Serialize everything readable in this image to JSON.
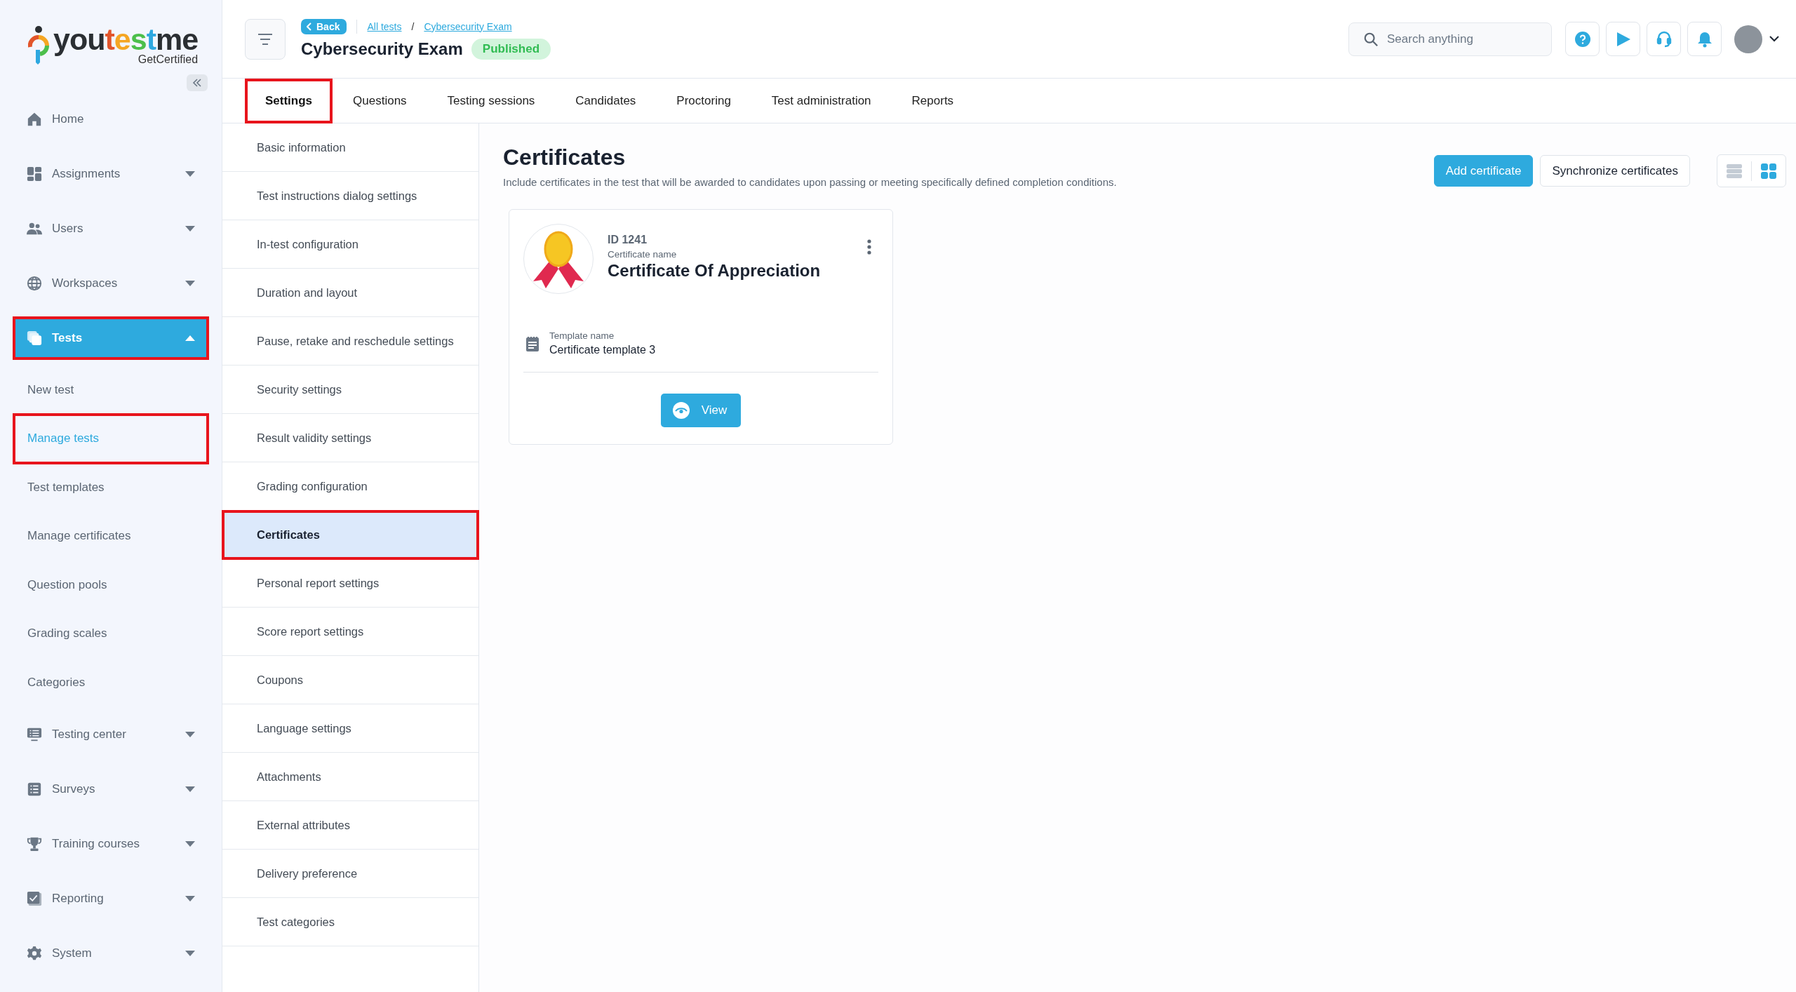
{
  "sidebar": {
    "logo": {
      "parts": [
        {
          "text": "you",
          "color": "#2b2f33"
        },
        {
          "text": "t",
          "color": "#e2552b"
        },
        {
          "text": "e",
          "color": "#f5a623"
        },
        {
          "text": "s",
          "color": "#4cbf4b"
        },
        {
          "text": "t",
          "color": "#2ea8e0"
        },
        {
          "text": "me",
          "color": "#2b2f33"
        }
      ],
      "tagline": "GetCertified"
    },
    "items": [
      {
        "kind": "top",
        "label": "Home",
        "selected": false,
        "annotated": false
      },
      {
        "kind": "group",
        "label": "Assignments",
        "expanded": false,
        "selected": false,
        "annotated": false
      },
      {
        "kind": "group",
        "label": "Users",
        "expanded": false,
        "selected": false,
        "annotated": false
      },
      {
        "kind": "group",
        "label": "Workspaces",
        "expanded": false,
        "selected": false,
        "annotated": false
      },
      {
        "kind": "group",
        "label": "Tests",
        "expanded": true,
        "selected": true,
        "annotated": true
      },
      {
        "kind": "sub",
        "label": "New test",
        "selected": false,
        "annotated": false
      },
      {
        "kind": "sub",
        "label": "Manage tests",
        "selected": true,
        "annotated": true
      },
      {
        "kind": "sub",
        "label": "Test templates",
        "selected": false,
        "annotated": false
      },
      {
        "kind": "sub",
        "label": "Manage certificates",
        "selected": false,
        "annotated": false
      },
      {
        "kind": "sub",
        "label": "Question pools",
        "selected": false,
        "annotated": false
      },
      {
        "kind": "sub",
        "label": "Grading scales",
        "selected": false,
        "annotated": false
      },
      {
        "kind": "sub",
        "label": "Categories",
        "selected": false,
        "annotated": false
      },
      {
        "kind": "group",
        "label": "Testing center",
        "expanded": false,
        "selected": false,
        "annotated": false
      },
      {
        "kind": "group",
        "label": "Surveys",
        "expanded": false,
        "selected": false,
        "annotated": false
      },
      {
        "kind": "group",
        "label": "Training courses",
        "expanded": false,
        "selected": false,
        "annotated": false
      },
      {
        "kind": "group",
        "label": "Reporting",
        "expanded": false,
        "selected": false,
        "annotated": false
      },
      {
        "kind": "group",
        "label": "System",
        "expanded": false,
        "selected": false,
        "annotated": false
      }
    ]
  },
  "header": {
    "back": "Back",
    "breadcrumbs": [
      "All tests",
      "Cybersecurity Exam"
    ],
    "breadcrumb_separator": "/",
    "title": "Cybersecurity Exam",
    "status": "Published",
    "search": {
      "placeholder": "Search anything"
    }
  },
  "tabs": [
    {
      "label": "Settings",
      "selected": true,
      "annotated": true
    },
    {
      "label": "Questions",
      "selected": false,
      "annotated": false
    },
    {
      "label": "Testing sessions",
      "selected": false,
      "annotated": false
    },
    {
      "label": "Candidates",
      "selected": false,
      "annotated": false
    },
    {
      "label": "Proctoring",
      "selected": false,
      "annotated": false
    },
    {
      "label": "Test administration",
      "selected": false,
      "annotated": false
    },
    {
      "label": "Reports",
      "selected": false,
      "annotated": false
    }
  ],
  "settings_menu": [
    {
      "label": "Basic information",
      "selected": false,
      "annotated": false
    },
    {
      "label": "Test instructions dialog settings",
      "selected": false,
      "annotated": false
    },
    {
      "label": "In-test configuration",
      "selected": false,
      "annotated": false
    },
    {
      "label": "Duration and layout",
      "selected": false,
      "annotated": false
    },
    {
      "label": "Pause, retake and reschedule settings",
      "selected": false,
      "annotated": false
    },
    {
      "label": "Security settings",
      "selected": false,
      "annotated": false
    },
    {
      "label": "Result validity settings",
      "selected": false,
      "annotated": false
    },
    {
      "label": "Grading configuration",
      "selected": false,
      "annotated": false
    },
    {
      "label": "Certificates",
      "selected": true,
      "annotated": true
    },
    {
      "label": "Personal report settings",
      "selected": false,
      "annotated": false
    },
    {
      "label": "Score report settings",
      "selected": false,
      "annotated": false
    },
    {
      "label": "Coupons",
      "selected": false,
      "annotated": false
    },
    {
      "label": "Language settings",
      "selected": false,
      "annotated": false
    },
    {
      "label": "Attachments",
      "selected": false,
      "annotated": false
    },
    {
      "label": "External attributes",
      "selected": false,
      "annotated": false
    },
    {
      "label": "Delivery preference",
      "selected": false,
      "annotated": false
    },
    {
      "label": "Test categories",
      "selected": false,
      "annotated": false
    }
  ],
  "content": {
    "title": "Certificates",
    "description": "Include certificates in the test that will be awarded to candidates upon passing or meeting specifically defined completion conditions.",
    "actions": [
      "Add certificate",
      "Synchronize certificates"
    ],
    "view_toggle": [
      {
        "kind": "list",
        "selected": false
      },
      {
        "kind": "grid",
        "selected": true
      }
    ],
    "certificates": [
      {
        "id": "ID 1241",
        "name_label": "Certificate name",
        "name": "Certificate Of Appreciation",
        "template_label": "Template name",
        "template": "Certificate template 3",
        "view": "View"
      }
    ]
  }
}
